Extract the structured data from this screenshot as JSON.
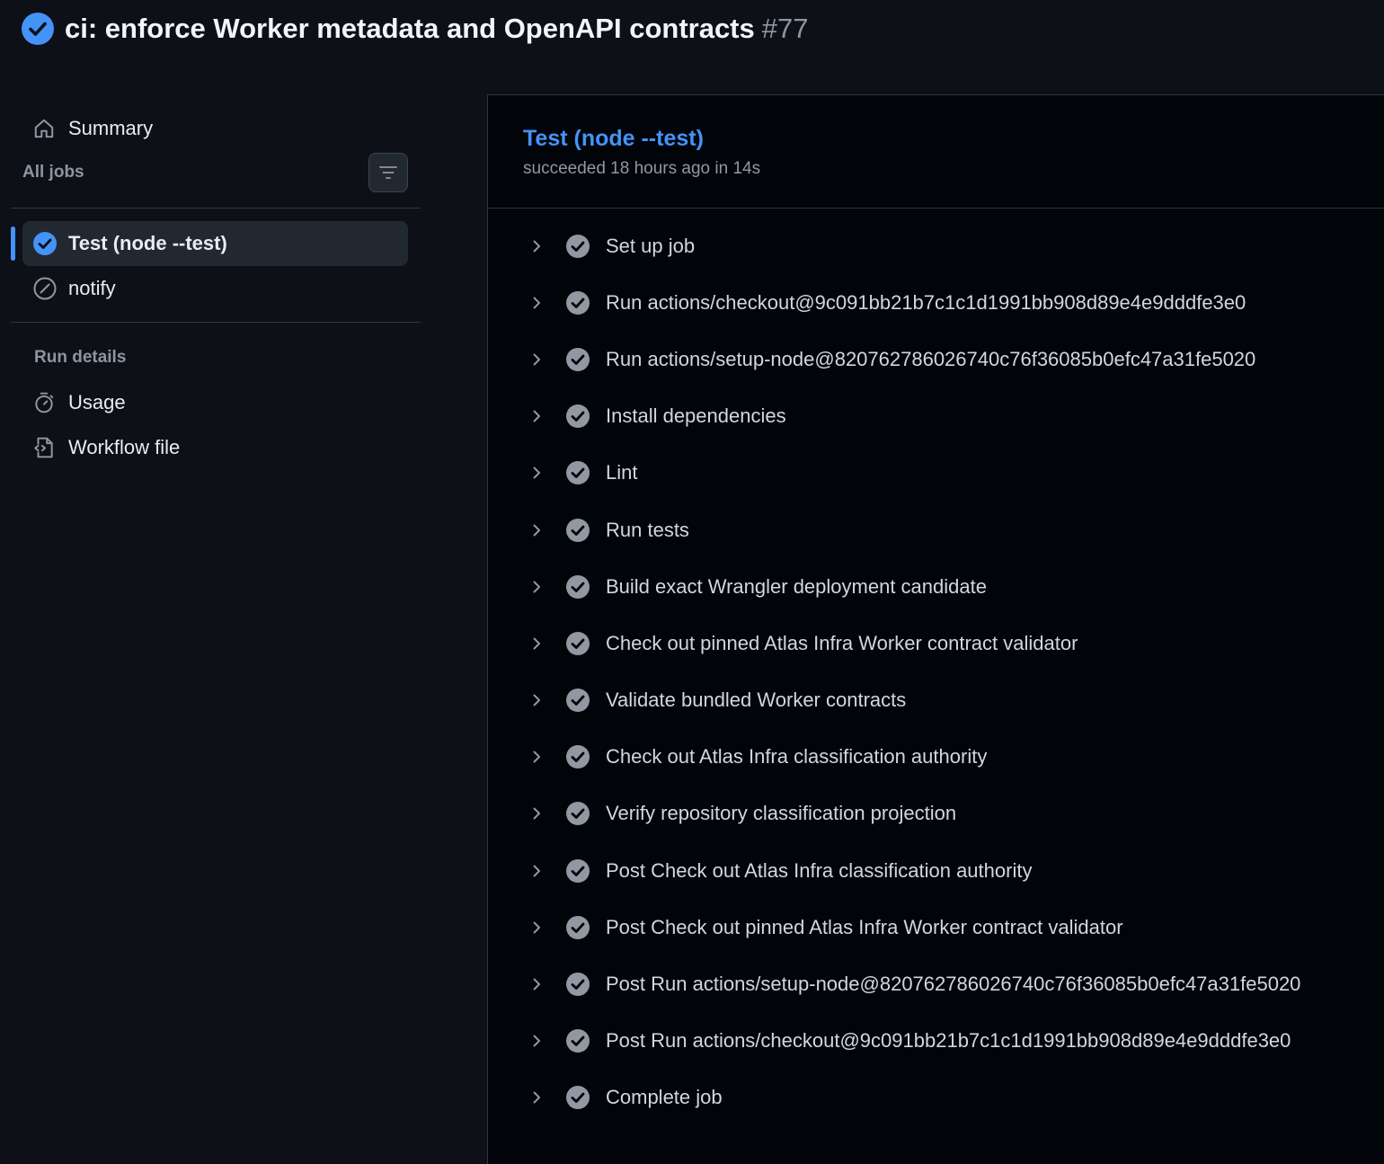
{
  "header": {
    "title": "ci: enforce Worker metadata and OpenAPI contracts",
    "run_number": "#77"
  },
  "sidebar": {
    "summary_label": "Summary",
    "all_jobs_label": "All jobs",
    "jobs": [
      {
        "label": "Test (node --test)",
        "status": "success",
        "active": true
      },
      {
        "label": "notify",
        "status": "skipped",
        "active": false
      }
    ],
    "run_details_label": "Run details",
    "run_details_items": [
      {
        "label": "Usage",
        "icon": "stopwatch-icon"
      },
      {
        "label": "Workflow file",
        "icon": "file-code-icon"
      }
    ]
  },
  "job": {
    "title": "Test (node --test)",
    "subtitle": "succeeded 18 hours ago in 14s",
    "steps": [
      "Set up job",
      "Run actions/checkout@9c091bb21b7c1c1d1991bb908d89e4e9dddfe3e0",
      "Run actions/setup-node@820762786026740c76f36085b0efc47a31fe5020",
      "Install dependencies",
      "Lint",
      "Run tests",
      "Build exact Wrangler deployment candidate",
      "Check out pinned Atlas Infra Worker contract validator",
      "Validate bundled Worker contracts",
      "Check out Atlas Infra classification authority",
      "Verify repository classification projection",
      "Post Check out Atlas Infra classification authority",
      "Post Check out pinned Atlas Infra Worker contract validator",
      "Post Run actions/setup-node@820762786026740c76f36085b0efc47a31fe5020",
      "Post Run actions/checkout@9c091bb21b7c1c1d1991bb908d89e4e9dddfe3e0",
      "Complete job"
    ]
  },
  "colors": {
    "accent": "#4493f8",
    "background": "#0d1117",
    "panel": "#010409",
    "step_check": "#9198a1"
  }
}
